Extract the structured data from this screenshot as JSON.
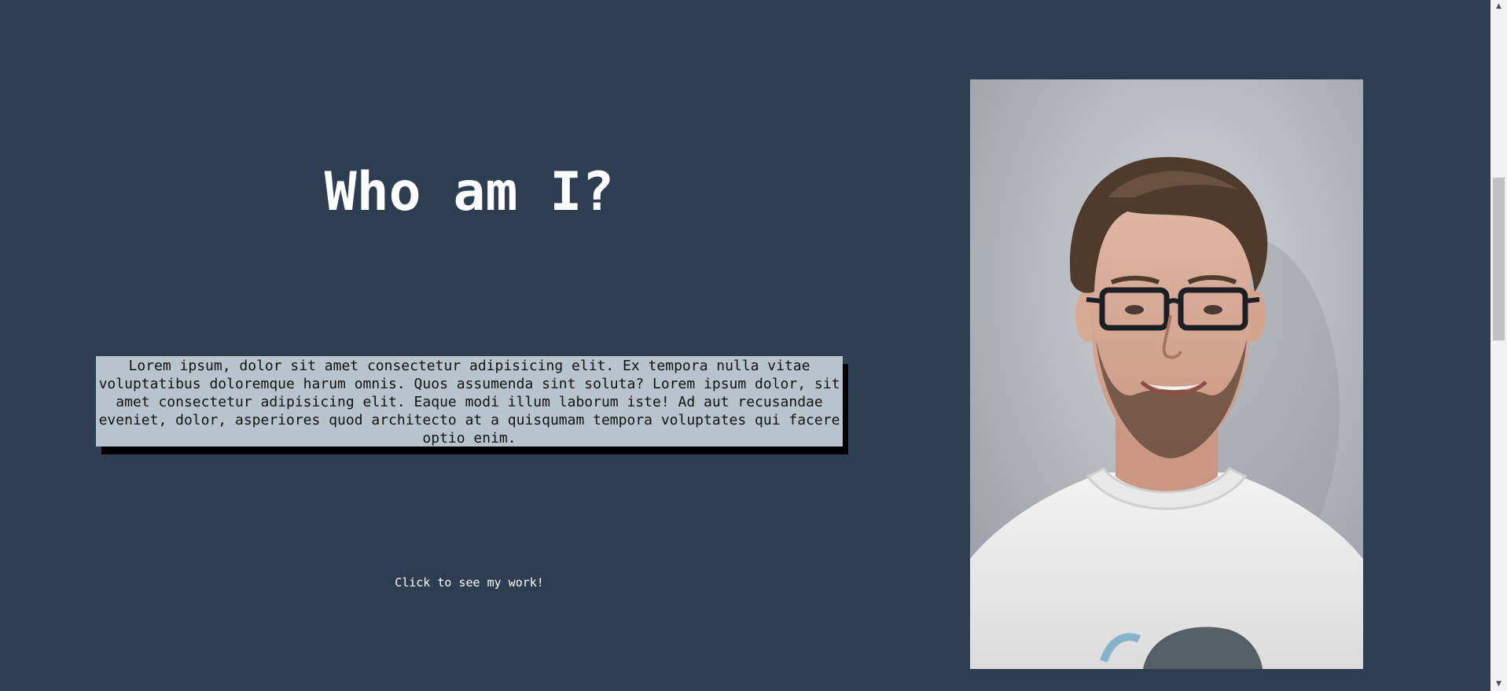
{
  "heading": "Who am I?",
  "bio": "Lorem ipsum, dolor sit amet consectetur adipisicing elit. Ex tempora nulla vitae voluptatibus doloremque harum omnis. Quos assumenda sint soluta? Lorem ipsum dolor, sit amet consectetur adipisicing elit. Eaque modi illum laborum iste! Ad aut recusandae eveniet, dolor, asperiores quod architecto at a quisqumam tempora voluptates qui facere optio enim.",
  "cta_label": "Click to see my work!",
  "colors": {
    "background": "#2e3e52",
    "bio_box": "#b8c4cc",
    "text_light": "#ffffff"
  },
  "scrollbar": {
    "up_icon": "▲",
    "down_icon": "▼"
  }
}
